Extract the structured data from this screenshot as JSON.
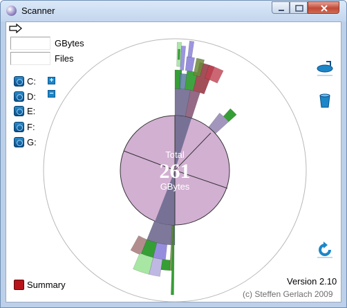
{
  "window": {
    "title": "Scanner"
  },
  "stats": {
    "gbytes_label": "GBytes",
    "files_label": "Files",
    "gbytes_value": "",
    "files_value": ""
  },
  "drives": [
    {
      "label": "C:",
      "control": "+"
    },
    {
      "label": "D:",
      "control": "−"
    },
    {
      "label": "E:"
    },
    {
      "label": "F:"
    },
    {
      "label": "G:"
    }
  ],
  "center": {
    "total_label": "Total",
    "total_value": "261",
    "unit_label": "GBytes"
  },
  "summary": {
    "label": "Summary"
  },
  "footer": {
    "version": "Version 2.10",
    "copyright": "(c) Steffen Gerlach 2009"
  },
  "colors": {
    "disk": "#d2b0d2",
    "disk_dark": "#777196",
    "green": "#2a9a2a",
    "dark_red": "#93303b",
    "purple": "#8b82d9",
    "light_green": "#9fe39a",
    "lavender": "#b8b0e0"
  },
  "icons": {
    "arrow": "arrow-right-icon",
    "drive": "drive-icon",
    "scanner_side": [
      "disk-rotate-icon",
      "trash-icon",
      "refresh-icon"
    ]
  }
}
